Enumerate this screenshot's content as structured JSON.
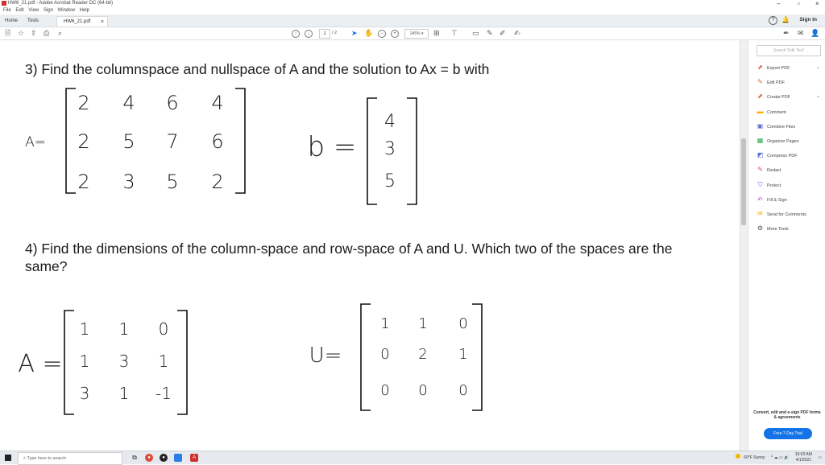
{
  "window": {
    "title": "HW6_21.pdf - Adobe Acrobat Reader DC (64-bit)",
    "minimize": "–",
    "maximize": "▫",
    "close": "×"
  },
  "menu": [
    "File",
    "Edit",
    "View",
    "Sign",
    "Window",
    "Help"
  ],
  "tabs": {
    "home": "Home",
    "tools": "Tools",
    "document": "HW6_21.pdf",
    "close": "×"
  },
  "header": {
    "sign_in": "Sign In",
    "help": "?"
  },
  "toolbar": {
    "page_current": "1",
    "page_total": "/ 2",
    "zoom": "145% ▾"
  },
  "document": {
    "q3": "3) Find the columnspace and nullspace of A and the solution to Ax = b with",
    "q4": "4) Find the dimensions of the column-space and row-space of A and U. Which two of the spaces are the same?",
    "label_A1": "A=",
    "A1": [
      [
        "2",
        "4",
        "6",
        "4"
      ],
      [
        "2",
        "5",
        "7",
        "6"
      ],
      [
        "2",
        "3",
        "5",
        "2"
      ]
    ],
    "label_b": "b =",
    "b": [
      "4",
      "3",
      "5"
    ],
    "label_A2": "A =",
    "A2": [
      [
        "1",
        "1",
        "0"
      ],
      [
        "1",
        "3",
        "1"
      ],
      [
        "3",
        "1",
        "-1"
      ]
    ],
    "label_U": "U=",
    "U": [
      [
        "1",
        "1",
        "0"
      ],
      [
        "0",
        "2",
        "1"
      ],
      [
        "0",
        "0",
        "0"
      ]
    ]
  },
  "right_pane": {
    "search_placeholder": "Search 'Edit Text'",
    "tools": [
      {
        "label": "Export PDF",
        "icon": "export-pdf-icon",
        "color": "#e2614b",
        "chevron": true
      },
      {
        "label": "Edit PDF",
        "icon": "edit-pdf-icon",
        "color": "#e2614b",
        "chevron": false
      },
      {
        "label": "Create PDF",
        "icon": "create-pdf-icon",
        "color": "#e2614b",
        "chevron": true
      },
      {
        "label": "Comment",
        "icon": "comment-icon",
        "color": "#f5b400",
        "chevron": false
      },
      {
        "label": "Combine Files",
        "icon": "combine-files-icon",
        "color": "#5a6fd6",
        "chevron": false
      },
      {
        "label": "Organize Pages",
        "icon": "organize-pages-icon",
        "color": "#2fa84f",
        "chevron": false
      },
      {
        "label": "Compress PDF",
        "icon": "compress-pdf-icon",
        "color": "#5a6fd6",
        "chevron": false
      },
      {
        "label": "Redact",
        "icon": "redact-icon",
        "color": "#e0457b",
        "chevron": false
      },
      {
        "label": "Protect",
        "icon": "protect-icon",
        "color": "#6b63d9",
        "chevron": false
      },
      {
        "label": "Fill & Sign",
        "icon": "fill-sign-icon",
        "color": "#b748c9",
        "chevron": false
      },
      {
        "label": "Send for Comments",
        "icon": "send-comments-icon",
        "color": "#f5b400",
        "chevron": false
      },
      {
        "label": "More Tools",
        "icon": "more-tools-icon",
        "color": "#555555",
        "chevron": false
      }
    ],
    "promo": "Convert, edit and e-sign PDF forms & agreements",
    "trial_button": "Free 7-Day Trial"
  },
  "taskbar": {
    "search_placeholder": "Type here to search",
    "weather": "60°F Sunny",
    "time": "10:03 AM",
    "date": "4/1/2021"
  },
  "colors": {
    "accent": "#1473e6",
    "taskbar": "#e6e9ee",
    "toolbar_bg": "#eceff2"
  }
}
